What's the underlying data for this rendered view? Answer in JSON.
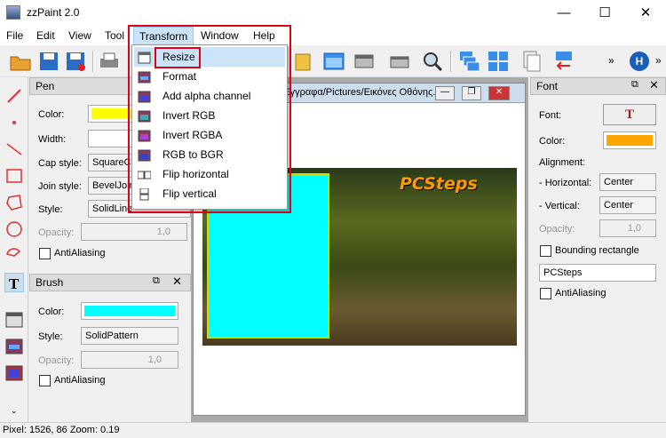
{
  "window": {
    "title": "zzPaint 2.0",
    "minimize": "—",
    "maximize": "☐",
    "close": "✕"
  },
  "menubar": [
    "File",
    "Edit",
    "View",
    "Tool",
    "Transform",
    "Window",
    "Help"
  ],
  "toolbar": {
    "overflow1": "»",
    "overflow2": "»",
    "help_icon_label": "H"
  },
  "transform_menu": [
    {
      "label": "Resize",
      "icon": "resize-icon"
    },
    {
      "label": "Format",
      "icon": "format-icon"
    },
    {
      "label": "Add alpha channel",
      "icon": "alpha-icon"
    },
    {
      "label": "Invert RGB",
      "icon": "invert-rgb-icon"
    },
    {
      "label": "Invert RGBA",
      "icon": "invert-rgba-icon"
    },
    {
      "label": "RGB to BGR",
      "icon": "rgb-bgr-icon"
    },
    {
      "label": "Flip horizontal",
      "icon": "flip-h-icon"
    },
    {
      "label": "Flip vertical",
      "icon": "flip-v-icon"
    }
  ],
  "pen_panel": {
    "title": "Pen",
    "color_label": "Color:",
    "color": "#ffff00",
    "width_label": "Width:",
    "width_value": "",
    "cap_label": "Cap style:",
    "cap_value": "SquareCap",
    "join_label": "Join style:",
    "join_value": "BevelJoin",
    "style_label": "Style:",
    "style_value": "SolidLine",
    "opacity_label": "Opacity:",
    "opacity_value": "1,0",
    "antialias_label": "AntiAliasing"
  },
  "brush_panel": {
    "title": "Brush",
    "color_label": "Color:",
    "color": "#00ffff",
    "style_label": "Style:",
    "style_value": "SolidPattern",
    "opacity_label": "Opacity:",
    "opacity_value": "1,0",
    "antialias_label": "AntiAliasing"
  },
  "font_panel": {
    "title": "Font",
    "font_label": "Font:",
    "color_label": "Color:",
    "color": "#ffa500",
    "alignment_label": "Alignment:",
    "horizontal_label": "- Horizontal:",
    "horizontal_value": "Center",
    "vertical_label": "- Vertical:",
    "vertical_value": "Center",
    "opacity_label": "Opacity:",
    "opacity_value": "1,0",
    "bounding_label": "Bounding rectangle",
    "text_value": "PCSteps",
    "antialias_label": "AntiAliasing"
  },
  "document": {
    "title": "Έγγραφα/Pictures/Εικόνες Οθόνης...",
    "canvas_text": "PCSteps"
  },
  "statusbar": {
    "text": "Pixel: 1526, 86  Zoom: 0.19"
  }
}
